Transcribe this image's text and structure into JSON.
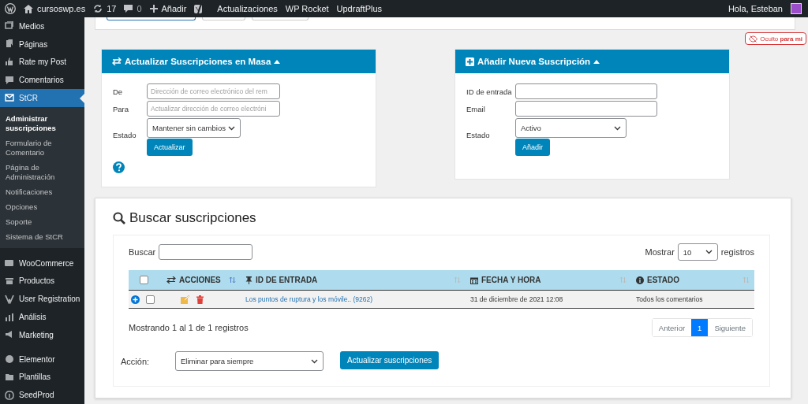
{
  "admin_bar": {
    "site": "cursoswp.es",
    "updates": "17",
    "comments": "0",
    "new": "Añadir",
    "items": [
      "Actualizaciones",
      "WP Rocket",
      "UpdraftPlus"
    ],
    "greeting": "Hola, Esteban"
  },
  "sidebar": {
    "items": [
      {
        "label": "Medios",
        "selected": false
      },
      {
        "label": "Páginas",
        "selected": false
      },
      {
        "label": "Rate my Post",
        "selected": false
      },
      {
        "label": "Comentarios",
        "selected": false
      },
      {
        "label": "StCR",
        "selected": true,
        "children": [
          {
            "label": "Administrar suscripciones",
            "selected": true
          },
          {
            "label": "Formulario de Comentario",
            "selected": false
          },
          {
            "label": "Página de Administración",
            "selected": false
          },
          {
            "label": "Notificaciones",
            "selected": false
          },
          {
            "label": "Opciones",
            "selected": false
          },
          {
            "label": "Soporte",
            "selected": false
          },
          {
            "label": "Sistema de StCR",
            "selected": false
          }
        ]
      },
      {
        "label": "WooCommerce",
        "selected": false
      },
      {
        "label": "Productos",
        "selected": false
      },
      {
        "label": "User Registration",
        "selected": false
      },
      {
        "label": "Análisis",
        "selected": false
      },
      {
        "label": "Marketing",
        "selected": false
      },
      {
        "label": "Elementor",
        "selected": false
      },
      {
        "label": "Plantillas",
        "selected": false
      },
      {
        "label": "SeedProd",
        "selected": false
      }
    ]
  },
  "hidden_badge": "Oculto **para mi**",
  "bulk_panel": {
    "title": "Actualizar Suscripciones en Masa",
    "expanded": true,
    "fields": [
      {
        "label": "De",
        "placeholder": "Dirección de correo electrónico del rem"
      },
      {
        "label": "Para",
        "placeholder": "Actualizar dirección de correo electróni"
      }
    ],
    "status": {
      "label": "Estado",
      "value": "Mantener sin cambios"
    },
    "button": "Actualizar"
  },
  "add_panel": {
    "title": "Añadir Nueva Suscripción",
    "expanded": true,
    "fields": [
      {
        "label": "ID de entrada"
      },
      {
        "label": "Email"
      }
    ],
    "status": {
      "label": "Estado",
      "value": "Activo"
    },
    "button": "Añadir"
  },
  "search": {
    "title": "Buscar suscripciones",
    "search_label": "Buscar",
    "show_label": "Mostrar",
    "page_size": "10",
    "records_label": "registros",
    "table": {
      "select_all": {
        "checked": false
      },
      "columns": [
        {
          "label": "ACCIONES",
          "sorted": true
        },
        {
          "label": "ID DE ENTRADA",
          "sorted": false
        },
        {
          "label": "FECHA Y HORA",
          "sorted": false
        },
        {
          "label": "ESTADO",
          "sorted": false
        }
      ],
      "rows": [
        {
          "checked": false,
          "post": "Los puntos de ruptura y los móvile.. (9262)",
          "date": "31 de diciembre de 2021 12:08",
          "status": "Todos los comentarios"
        }
      ]
    },
    "summary": "Mostrando 1 al 1 de 1 registros",
    "pagination": {
      "previous": "Anterior",
      "pages": [
        {
          "label": "1",
          "selected": true
        }
      ],
      "next": "Siguiente"
    },
    "action": {
      "label": "Acción:",
      "value": "Eliminar para siempre"
    },
    "submit": "Actualizar suscripciones"
  }
}
